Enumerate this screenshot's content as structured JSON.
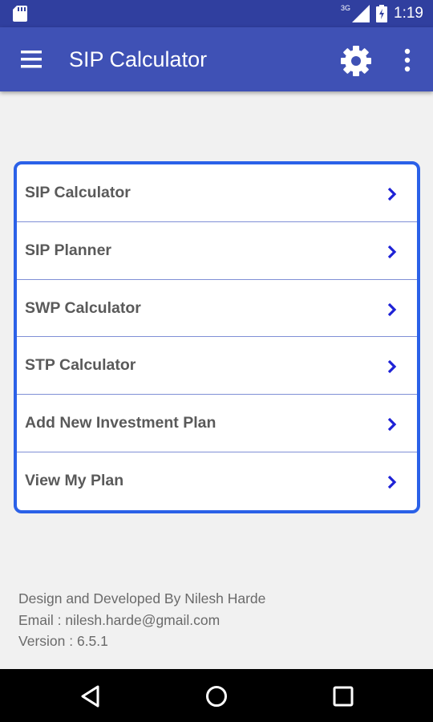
{
  "status_bar": {
    "network": "3G",
    "time": "1:19"
  },
  "app_bar": {
    "title": "SIP Calculator",
    "menu_icon": "hamburger-menu-icon",
    "settings_icon": "gear-icon",
    "overflow_icon": "more-vert-icon"
  },
  "menu": {
    "items": [
      {
        "label": "SIP Calculator"
      },
      {
        "label": "SIP Planner"
      },
      {
        "label": "SWP Calculator"
      },
      {
        "label": "STP Calculator"
      },
      {
        "label": "Add New Investment Plan"
      },
      {
        "label": "View My Plan"
      }
    ]
  },
  "footer": {
    "credit": "Design and Developed By Nilesh Harde",
    "email": "Email : nilesh.harde@gmail.com",
    "version": "Version : 6.5.1"
  },
  "colors": {
    "status_bar": "#303f9f",
    "app_bar": "#3f51b5",
    "card_border": "#2b61e8",
    "chevron": "#1e22d6"
  }
}
